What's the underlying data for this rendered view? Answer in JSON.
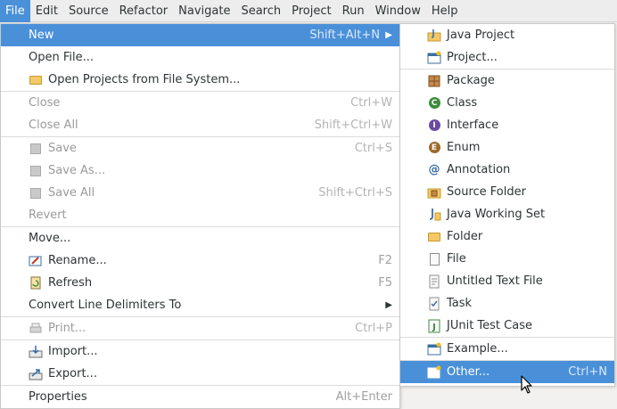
{
  "menubar": {
    "items": [
      {
        "label": "File",
        "active": true
      },
      {
        "label": "Edit"
      },
      {
        "label": "Source"
      },
      {
        "label": "Refactor"
      },
      {
        "label": "Navigate"
      },
      {
        "label": "Search"
      },
      {
        "label": "Project"
      },
      {
        "label": "Run"
      },
      {
        "label": "Window"
      },
      {
        "label": "Help"
      }
    ]
  },
  "file_menu": {
    "new": {
      "label": "New",
      "accel": "Shift+Alt+N"
    },
    "open_file": {
      "label": "Open File..."
    },
    "open_projects": {
      "label": "Open Projects from File System..."
    },
    "close": {
      "label": "Close",
      "accel": "Ctrl+W"
    },
    "close_all": {
      "label": "Close All",
      "accel": "Shift+Ctrl+W"
    },
    "save": {
      "label": "Save",
      "accel": "Ctrl+S"
    },
    "save_as": {
      "label": "Save As..."
    },
    "save_all": {
      "label": "Save All",
      "accel": "Shift+Ctrl+S"
    },
    "revert": {
      "label": "Revert"
    },
    "move": {
      "label": "Move..."
    },
    "rename": {
      "label": "Rename...",
      "accel": "F2"
    },
    "refresh": {
      "label": "Refresh",
      "accel": "F5"
    },
    "convert": {
      "label": "Convert Line Delimiters To"
    },
    "print": {
      "label": "Print...",
      "accel": "Ctrl+P"
    },
    "import": {
      "label": "Import..."
    },
    "export": {
      "label": "Export..."
    },
    "properties": {
      "label": "Properties",
      "accel": "Alt+Enter"
    }
  },
  "new_submenu": {
    "java_project": {
      "label": "Java Project"
    },
    "project": {
      "label": "Project..."
    },
    "package": {
      "label": "Package"
    },
    "class": {
      "label": "Class"
    },
    "interface": {
      "label": "Interface"
    },
    "enum": {
      "label": "Enum"
    },
    "annotation": {
      "label": "Annotation"
    },
    "source_folder": {
      "label": "Source Folder"
    },
    "java_working_set": {
      "label": "Java Working Set"
    },
    "folder": {
      "label": "Folder"
    },
    "file": {
      "label": "File"
    },
    "untitled_text_file": {
      "label": "Untitled Text File"
    },
    "task": {
      "label": "Task"
    },
    "junit_test_case": {
      "label": "JUnit Test Case"
    },
    "example": {
      "label": "Example..."
    },
    "other": {
      "label": "Other...",
      "accel": "Ctrl+N"
    }
  },
  "colors": {
    "highlight": "#4a90d9",
    "menu_bg": "#ffffff",
    "menubar_bg": "#ededed"
  }
}
